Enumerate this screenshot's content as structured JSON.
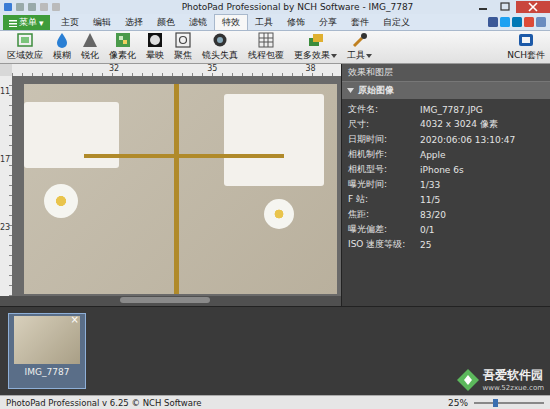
{
  "window": {
    "title": "PhotoPad Professional by NCH Software - IMG_7787"
  },
  "menu_button": {
    "label": "菜单",
    "arrow": "▾"
  },
  "tabs": [
    {
      "label": "主页",
      "selected": false
    },
    {
      "label": "编辑",
      "selected": false
    },
    {
      "label": "选择",
      "selected": false
    },
    {
      "label": "颜色",
      "selected": false
    },
    {
      "label": "滤镜",
      "selected": false
    },
    {
      "label": "特效",
      "selected": true
    },
    {
      "label": "工具",
      "selected": false
    },
    {
      "label": "修饰",
      "selected": false
    },
    {
      "label": "分享",
      "selected": false
    },
    {
      "label": "套件",
      "selected": false
    },
    {
      "label": "自定义",
      "selected": false
    }
  ],
  "toolbar": [
    {
      "label": "区域效应",
      "dropdown": false
    },
    {
      "label": "模糊",
      "dropdown": false
    },
    {
      "label": "锐化",
      "dropdown": false
    },
    {
      "label": "像素化",
      "dropdown": false
    },
    {
      "label": "晕映",
      "dropdown": false
    },
    {
      "label": "聚焦",
      "dropdown": false
    },
    {
      "label": "镜头失真",
      "dropdown": false
    },
    {
      "label": "线程包覆",
      "dropdown": false
    },
    {
      "label": "更多效果",
      "dropdown": true
    },
    {
      "label": "工具",
      "dropdown": true
    }
  ],
  "suite_button": {
    "label": "NCH套件"
  },
  "rulers": {
    "top": [
      "32",
      "35",
      "38"
    ],
    "left": [
      "11",
      "17",
      "23"
    ]
  },
  "panel": {
    "title": "效果和图层",
    "section": "原始图像",
    "expanded": true,
    "properties": [
      {
        "name": "文件名:",
        "value": "IMG_7787.JPG"
      },
      {
        "name": "尺寸:",
        "value": "4032 x 3024 像素"
      },
      {
        "name": "日期时间:",
        "value": "2020:06:06 13:10:47"
      },
      {
        "name": "相机制作:",
        "value": "Apple"
      },
      {
        "name": "相机型号:",
        "value": "iPhone 6s"
      },
      {
        "name": "曝光时间:",
        "value": "1/33"
      },
      {
        "name": "F 站:",
        "value": "11/5"
      },
      {
        "name": "焦距:",
        "value": "83/20"
      },
      {
        "name": "曝光偏差:",
        "value": "0/1"
      },
      {
        "name": "ISO 速度等级:",
        "value": "25"
      }
    ]
  },
  "thumbnails": [
    {
      "label": "IMG_7787",
      "selected": true,
      "close": "×"
    }
  ],
  "status_bar": {
    "text": "PhotoPad Professional v 6.25 © NCH Software",
    "zoom": "25%",
    "level": 0.3
  },
  "watermark": {
    "name": "吾爱软件园",
    "url": "www.52zxue.com"
  }
}
